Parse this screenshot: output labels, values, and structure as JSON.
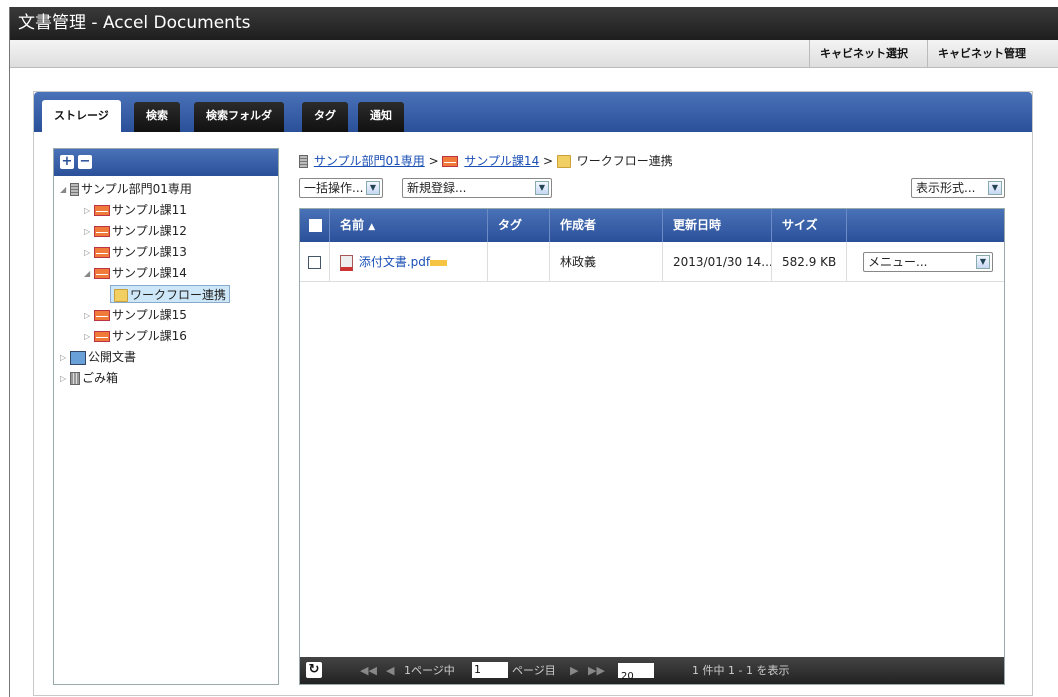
{
  "window": {
    "title": "文書管理 - Accel Documents"
  },
  "cabinet_bar": {
    "select_label": "キャビネット選択",
    "manage_label": "キャビネット管理"
  },
  "tabs": [
    {
      "label": "ストレージ",
      "active": true
    },
    {
      "label": "検索"
    },
    {
      "label": "検索フォルダ"
    },
    {
      "label": "タグ"
    },
    {
      "label": "通知"
    }
  ],
  "tree": {
    "expand_label": "+",
    "collapse_label": "−",
    "nodes": [
      {
        "label": "サンプル部門01専用",
        "icon": "server-icon"
      },
      {
        "label": "サンプル課11",
        "icon": "envelope-icon"
      },
      {
        "label": "サンプル課12",
        "icon": "envelope-icon"
      },
      {
        "label": "サンプル課13",
        "icon": "envelope-icon"
      },
      {
        "label": "サンプル課14",
        "icon": "envelope-icon"
      },
      {
        "label": "ワークフロー連携",
        "icon": "folder-icon",
        "selected": true
      },
      {
        "label": "サンプル課15",
        "icon": "envelope-icon"
      },
      {
        "label": "サンプル課16",
        "icon": "envelope-icon"
      },
      {
        "label": "公開文書",
        "icon": "documents-icon"
      },
      {
        "label": "ごみ箱",
        "icon": "trash-icon"
      }
    ]
  },
  "breadcrumb": {
    "items": [
      "サンプル部門01専用",
      "サンプル課14",
      "ワークフロー連携"
    ],
    "separator": ">"
  },
  "toolbar": {
    "bulk_action": "一括操作...",
    "new_register": "新規登録...",
    "view_format": "表示形式..."
  },
  "grid": {
    "columns": [
      "名前",
      "タグ",
      "作成者",
      "更新日時",
      "サイズ"
    ],
    "rows": [
      {
        "name": "添付文書.pdf",
        "tag": "",
        "author": "林政義",
        "updated": "2013/01/30 14...",
        "size": "582.9 KB",
        "menu": "メニュー..."
      }
    ]
  },
  "pager": {
    "page_prefix": "1ページ中",
    "page_value": "1",
    "page_suffix": "ページ目",
    "page_size": "20",
    "status": "1 件中 1 - 1 を表示"
  },
  "colors": {
    "header_blue": "#2a5099",
    "link": "#1a4fb5",
    "title_bar": "#1e1e1e"
  }
}
